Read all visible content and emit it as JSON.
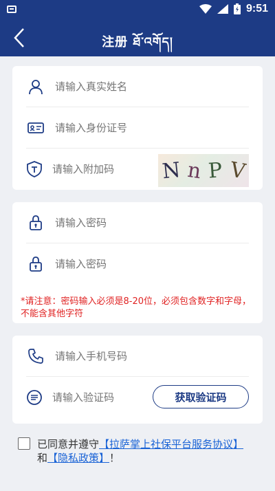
{
  "status": {
    "time": "9:51"
  },
  "header": {
    "title": "注册 ཐོ་འགོད།"
  },
  "identity_card": {
    "name_placeholder": "请输入真实姓名",
    "id_placeholder": "请输入身份证号",
    "captcha_placeholder": "请输入附加码",
    "captcha_chars": [
      "N",
      "n",
      "P",
      "V"
    ]
  },
  "password_card": {
    "password_placeholder": "请输入密码",
    "confirm_placeholder": "请输入密码",
    "notice": "*请注意：密码输入必须是8-20位，必须包含数字和字母，不能含其他字符"
  },
  "phone_card": {
    "phone_placeholder": "请输入手机号码",
    "code_placeholder": "请输入验证码",
    "get_code_label": "获取验证码"
  },
  "agreement": {
    "prefix": "已同意并遵守",
    "service_link": "【拉萨掌上社保平台服务协议】",
    "and": "和",
    "privacy_link": "【隐私政策】",
    "suffix": "！"
  },
  "colors": {
    "brand": "#1d3b85",
    "warning": "#e02222",
    "link": "#1a63d6"
  }
}
